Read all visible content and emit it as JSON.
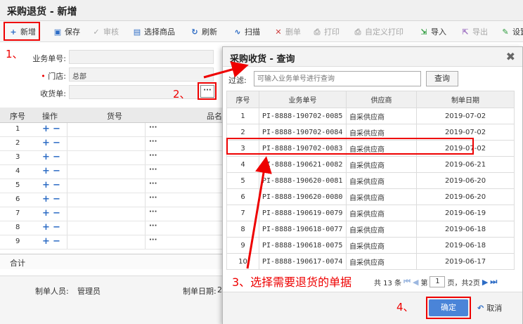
{
  "window": {
    "title": "采购退货 - 新增"
  },
  "toolbar": [
    {
      "label": "新增",
      "icon": "add-doc-icon",
      "glyph": "+",
      "color": "#2d6cc5",
      "disabled": false
    },
    {
      "label": "保存",
      "icon": "save-icon",
      "glyph": "▣",
      "color": "#2d6cc5",
      "disabled": false
    },
    {
      "label": "审核",
      "icon": "check-icon",
      "glyph": "✓",
      "color": "#a8a8a8",
      "disabled": true
    },
    {
      "label": "选择商品",
      "icon": "cart-icon",
      "glyph": "▤",
      "color": "#2d6cc5",
      "disabled": false
    },
    {
      "label": "刷新",
      "icon": "refresh-icon",
      "glyph": "↻",
      "color": "#2d6cc5",
      "disabled": false
    },
    {
      "label": "扫描",
      "icon": "scan-icon",
      "glyph": "∿",
      "color": "#2d6cc5",
      "disabled": false
    },
    {
      "label": "删单",
      "icon": "delete-icon",
      "glyph": "✕",
      "color": "#d04040",
      "disabled": true
    },
    {
      "label": "打印",
      "icon": "print-icon",
      "glyph": "⎙",
      "color": "#a8a8a8",
      "disabled": true
    },
    {
      "label": "自定义打印",
      "icon": "custom-print-icon",
      "glyph": "⎙",
      "color": "#a8a8a8",
      "disabled": true
    },
    {
      "label": "导入",
      "icon": "import-icon",
      "glyph": "⇲",
      "color": "#2a9a3a",
      "disabled": false
    },
    {
      "label": "导出",
      "icon": "export-icon",
      "glyph": "⇱",
      "color": "#9a6ac0",
      "disabled": true
    },
    {
      "label": "设置",
      "icon": "settings-icon",
      "glyph": "✎",
      "color": "#2a9a3a",
      "disabled": false
    }
  ],
  "form": {
    "doc_no_label": "业务单号:",
    "store_label": "门店:",
    "store_value": "总部",
    "receipt_label": "收货单:",
    "dots": "···"
  },
  "grid": {
    "headers": [
      "序号",
      "操作",
      "货号",
      "品名"
    ],
    "rows": [
      "1",
      "2",
      "3",
      "4",
      "5",
      "6",
      "7",
      "8",
      "9"
    ],
    "plus": "+",
    "minus": "−",
    "dots": "···",
    "total_label": "合计"
  },
  "footer": {
    "creator_label": "制单人员:",
    "creator_value": "管理员",
    "date_label": "制单日期:",
    "date_value": "2"
  },
  "modal": {
    "title": "采购收货 - 查询",
    "close": "✖",
    "filter_label": "过滤:",
    "filter_placeholder": "可输入业务单号进行查询",
    "query_button": "查询",
    "columns": [
      "序号",
      "业务单号",
      "供应商",
      "制单日期"
    ],
    "rows": [
      [
        "1",
        "PI-8888-190702-0085",
        "自采供应商",
        "2019-07-02"
      ],
      [
        "2",
        "PI-8888-190702-0084",
        "自采供应商",
        "2019-07-02"
      ],
      [
        "3",
        "PI-8888-190702-0083",
        "自采供应商",
        "2019-07-02"
      ],
      [
        "4",
        "PI-8888-190621-0082",
        "自采供应商",
        "2019-06-21"
      ],
      [
        "5",
        "PI-8888-190620-0081",
        "自采供应商",
        "2019-06-20"
      ],
      [
        "6",
        "PI-8888-190620-0080",
        "自采供应商",
        "2019-06-20"
      ],
      [
        "7",
        "PI-8888-190619-0079",
        "自采供应商",
        "2019-06-19"
      ],
      [
        "8",
        "PI-8888-190618-0077",
        "自采供应商",
        "2019-06-18"
      ],
      [
        "9",
        "PI-8888-190618-0075",
        "自采供应商",
        "2019-06-18"
      ],
      [
        "10",
        "PI-8888-190617-0074",
        "自采供应商",
        "2019-06-17"
      ]
    ],
    "pager": {
      "total_text": "共 13 条",
      "first": "⏮",
      "prev": "◀",
      "page_prefix": "第",
      "page_value": "1",
      "page_suffix": "页，共2页",
      "next": "▶",
      "last": "⏭"
    },
    "ok_button": "确定",
    "cancel_button": "取消",
    "cancel_icon": "↶"
  },
  "annotations": {
    "a1": "1、",
    "a2": "2、",
    "a3": "3、选择需要退货的单据",
    "a4": "4、"
  },
  "colors": {
    "accent": "#2d6cc5",
    "highlight": "#e00000",
    "ok_button": "#4a84d8"
  }
}
